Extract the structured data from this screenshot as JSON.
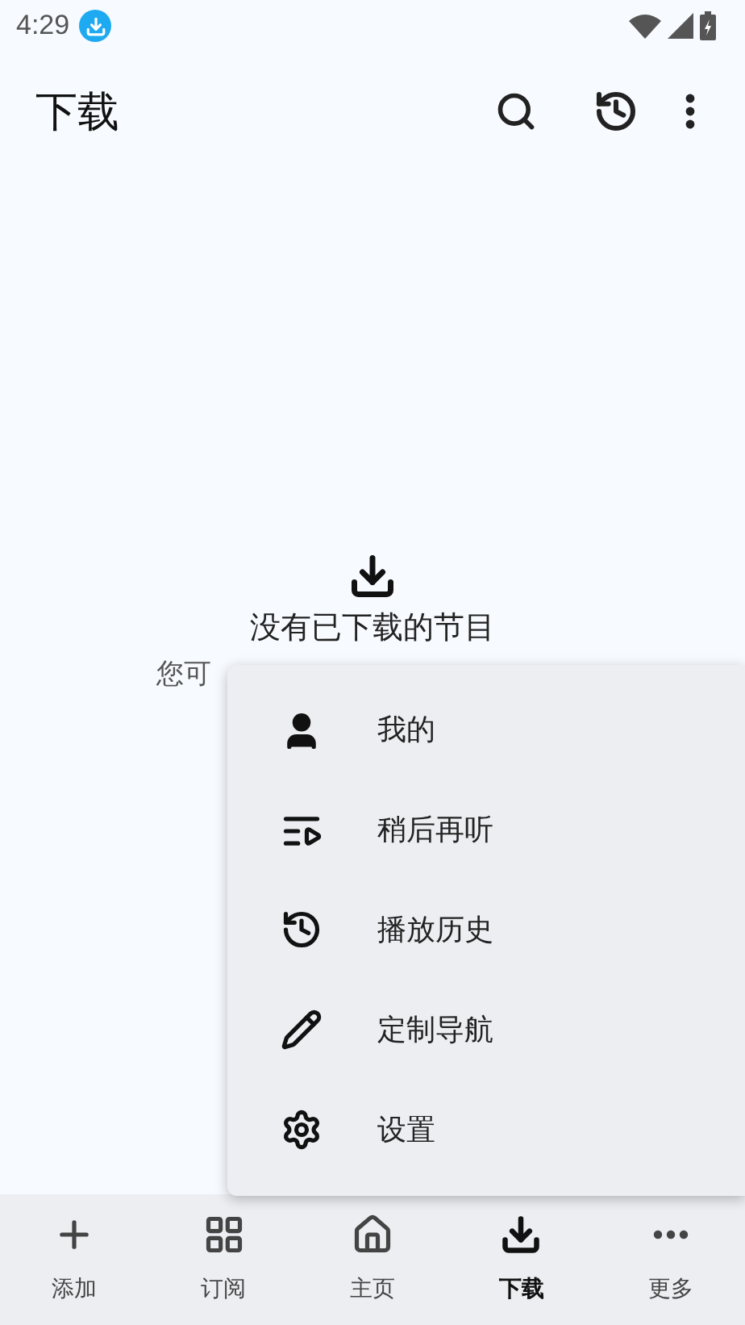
{
  "status_bar": {
    "time": "4:29"
  },
  "app_bar": {
    "title": "下载"
  },
  "empty_state": {
    "title": "没有已下载的节目",
    "subtitle": "您可"
  },
  "menu": [
    {
      "kind": "person",
      "label": "我的"
    },
    {
      "kind": "queue",
      "label": "稍后再听"
    },
    {
      "kind": "history",
      "label": "播放历史"
    },
    {
      "kind": "edit",
      "label": "定制导航"
    },
    {
      "kind": "settings",
      "label": "设置"
    }
  ],
  "bottom_nav": [
    {
      "kind": "add",
      "label": "添加",
      "selected": false
    },
    {
      "kind": "grid",
      "label": "订阅",
      "selected": false
    },
    {
      "kind": "home",
      "label": "主页",
      "selected": false
    },
    {
      "kind": "download",
      "label": "下载",
      "selected": true
    },
    {
      "kind": "more",
      "label": "更多",
      "selected": false
    }
  ]
}
